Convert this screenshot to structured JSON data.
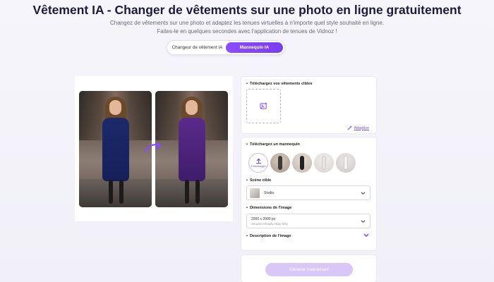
{
  "header": {
    "title": "Vêtement IA - Changer de vêtements sur une photo en ligne gratuitement",
    "subtitle_line1": "Changez de vêtements sur une photo et adaptez les tenues virtuelles à n'importe quel style souhaité en ligne.",
    "subtitle_line2": "Faites-le en quelques secondes avec l'application de tenues de Vidnoz !"
  },
  "tabs": [
    {
      "label": "Changeur de vêtement IA",
      "active": false
    },
    {
      "label": "Mannequin IA",
      "active": true
    }
  ],
  "clothes_section": {
    "label": "Téléchargez vos vêtements cibles",
    "adaptive_label": "Adaptive"
  },
  "model_section": {
    "label": "Téléchargez un mannequin",
    "upload_label": "Téléchargez",
    "models": [
      "model-1",
      "model-2",
      "model-3",
      "model-4"
    ]
  },
  "scene": {
    "label": "Scène cible",
    "value": "Studio"
  },
  "dimensions": {
    "label": "Dimensions de l'image",
    "value": "2000 x 2000 px",
    "sub": "Amazon Shopify eBay Etsy"
  },
  "description": {
    "label": "Description de l'image"
  },
  "generate": {
    "label": "Générer maintenant"
  },
  "colors": {
    "accent": "#7a3cf0",
    "accent_light": "#d8c7f7",
    "title": "#1c1c3a"
  }
}
